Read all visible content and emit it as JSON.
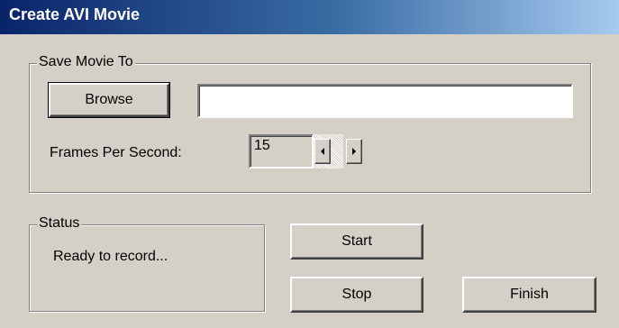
{
  "window": {
    "title": "Create AVI Movie"
  },
  "save_group": {
    "legend": "Save Movie To",
    "browse_label": "Browse",
    "path_value": "",
    "fps_label": "Frames Per Second:",
    "fps_value": "15"
  },
  "status_group": {
    "legend": "Status",
    "message": "Ready to record..."
  },
  "buttons": {
    "start_label": "Start",
    "stop_label": "Stop",
    "finish_label": "Finish"
  },
  "icons": {
    "spin_left": "arrow-left-icon",
    "spin_right": "arrow-right-icon"
  },
  "colors": {
    "titlebar_start": "#0a246a",
    "titlebar_end": "#a6caf0",
    "face": "#d4d0c8"
  }
}
